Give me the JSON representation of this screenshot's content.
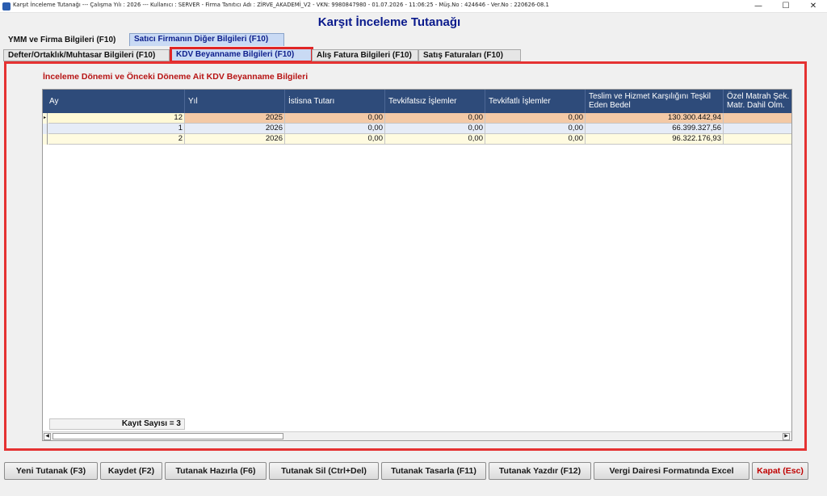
{
  "window": {
    "title": "Karşıt İnceleme Tutanağı  ---  Çalışma Yılı : 2026  ---  Kullanıcı : SERVER - Firma Tanıtıcı Adı : ZİRVE_AKADEMİ_V2 - VKN: 9980847980 - 01.07.2026 - 11:06:25 - Müş.No : 424646 - Ver.No : 220626-08.1",
    "minimize": "—",
    "maximize": "☐",
    "close": "✕"
  },
  "header": {
    "title": "Karşıt İnceleme Tutanağı"
  },
  "tabs_row1": [
    "YMM ve Firma Bilgileri (F10)",
    "Satıcı Firmanın Diğer Bilgileri (F10)"
  ],
  "tabs_row2": [
    "Defter/Ortaklık/Muhtasar Bilgileri (F10)",
    "KDV Beyanname Bilgileri (F10)",
    "Alış Fatura Bilgileri (F10)",
    "Satış Faturaları (F10)"
  ],
  "panel": {
    "title": "İnceleme Dönemi ve Önceki Döneme Ait KDV Beyanname Bilgileri",
    "columns": [
      "Ay",
      "Yıl",
      "İstisna Tutarı",
      "Tevkifatsız İşlemler",
      "Tevkifatlı İşlemler",
      "Teslim ve Hizmet Karşılığını Teşkil Eden Bedel",
      "Özel Matrah Şek. Matr. Dahil Olm."
    ],
    "rows": [
      [
        "12",
        "2025",
        "0,00",
        "0,00",
        "0,00",
        "130.300.442,94",
        ""
      ],
      [
        "1",
        "2026",
        "0,00",
        "0,00",
        "0,00",
        "66.399.327,56",
        ""
      ],
      [
        "2",
        "2026",
        "0,00",
        "0,00",
        "0,00",
        "96.322.176,93",
        ""
      ]
    ],
    "record_count": "Kayıt Sayısı = 3",
    "row_indicator": "▸"
  },
  "buttons": {
    "new": "Yeni Tutanak (F3)",
    "save": "Kaydet (F2)",
    "prepare": "Tutanak Hazırla (F6)",
    "delete": "Tutanak Sil (Ctrl+Del)",
    "design": "Tutanak Tasarla (F11)",
    "print": "Tutanak Yazdır (F12)",
    "excel": "Vergi Dairesi Formatında Excel",
    "close": "Kapat (Esc)"
  },
  "colors": {
    "header_blue": "#2e4b7a",
    "row_selected": "#f3c9a6",
    "row_alt_blue": "#e6ecf7",
    "row_alt_yellow": "#fffbe0",
    "highlight_red": "#e53232"
  }
}
